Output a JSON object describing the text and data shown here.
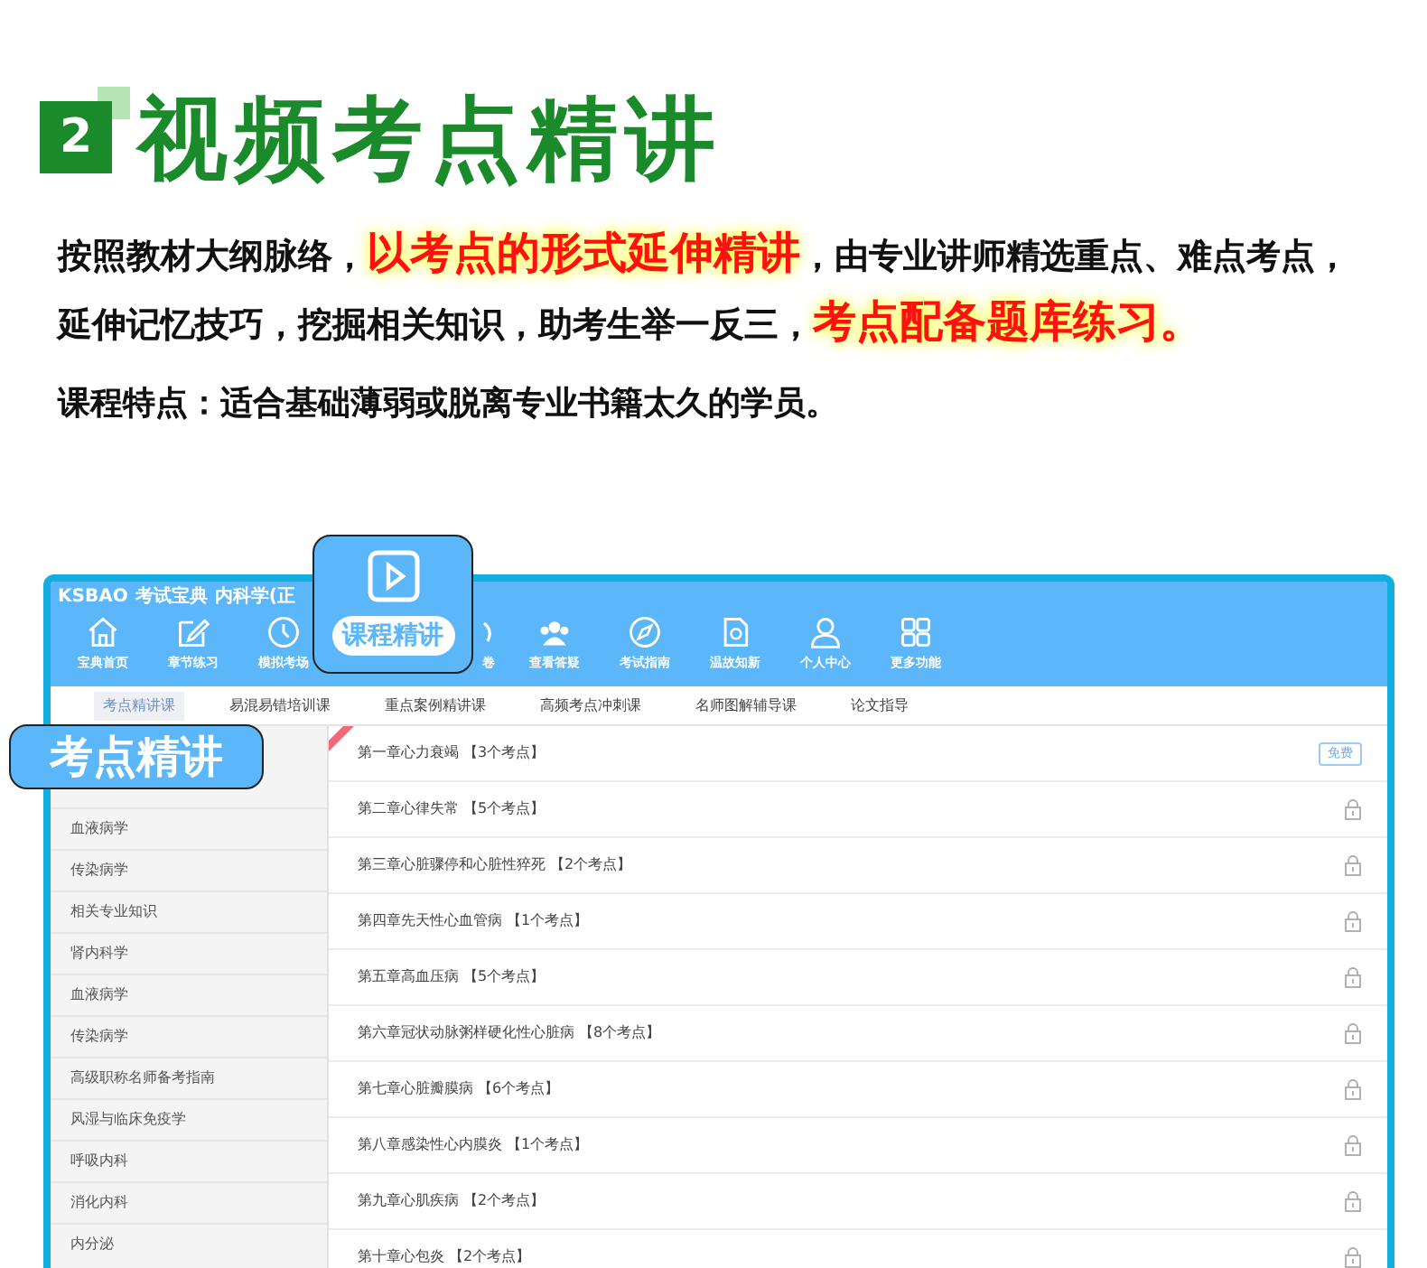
{
  "heading": {
    "badge": "2",
    "title": "视频考点精讲"
  },
  "intro": [
    {
      "text": "按照教材大纲脉络，",
      "highlight": false
    },
    {
      "text": "以考点的形式延伸精讲",
      "highlight": true
    },
    {
      "text": "，由专业讲师精选重点、难点考点，延伸记忆技巧，挖掘相关知识，助考生举一反三，",
      "highlight": false
    },
    {
      "text": "考点配备题库练习。",
      "highlight": true
    }
  ],
  "feature": "课程特点：适合基础薄弱或脱离专业书籍太久的学员。",
  "app": {
    "logo": "KSBAO",
    "brand": "考试宝典",
    "subject": "内科学(正",
    "nav": [
      {
        "label": "宝典首页",
        "kind": "home"
      },
      {
        "label": "章节练习",
        "kind": "edit"
      },
      {
        "label": "模拟考场",
        "kind": "clock"
      },
      {
        "kind": "none"
      },
      {
        "label": "卷",
        "kind": "partial"
      },
      {
        "label": "查看答疑",
        "kind": "people"
      },
      {
        "label": "考试指南",
        "kind": "compass"
      },
      {
        "label": "温故知新",
        "kind": "doc"
      },
      {
        "label": "个人中心",
        "kind": "user"
      },
      {
        "label": "更多功能",
        "kind": "grid"
      }
    ],
    "tabs": [
      {
        "label": "考点精讲课",
        "selected": true
      },
      {
        "label": "易混易错培训课",
        "selected": false
      },
      {
        "label": "重点案例精讲课",
        "selected": false
      },
      {
        "label": "高频考点冲刺课",
        "selected": false
      },
      {
        "label": "名师图解辅导课",
        "selected": false
      },
      {
        "label": "论文指导",
        "selected": false
      }
    ],
    "sidebar": [
      "血液病学",
      "传染病学",
      "相关专业知识",
      "肾内科学",
      "血液病学",
      "传染病学",
      "高级职称名师备考指南",
      "风湿与临床免疫学",
      "呼吸内科",
      "消化内科",
      "内分泌"
    ],
    "chapters": [
      {
        "title": "第一章心力衰竭 【3个考点】",
        "free": true,
        "badge": "免费",
        "new": true
      },
      {
        "title": "第二章心律失常 【5个考点】",
        "free": false,
        "new": false
      },
      {
        "title": "第三章心脏骤停和心脏性猝死 【2个考点】",
        "free": false,
        "new": false
      },
      {
        "title": "第四章先天性心血管病 【1个考点】",
        "free": false,
        "new": false
      },
      {
        "title": "第五章高血压病 【5个考点】",
        "free": false,
        "new": false
      },
      {
        "title": "第六章冠状动脉粥样硬化性心脏病 【8个考点】",
        "free": false,
        "new": false
      },
      {
        "title": "第七章心脏瓣膜病 【6个考点】",
        "free": false,
        "new": false
      },
      {
        "title": "第八章感染性心内膜炎 【1个考点】",
        "free": false,
        "new": false
      },
      {
        "title": "第九章心肌疾病 【2个考点】",
        "free": false,
        "new": false
      },
      {
        "title": "第十章心包炎 【2个考点】",
        "free": false,
        "new": false
      }
    ]
  },
  "callouts": {
    "course": "课程精讲",
    "section": "考点精讲"
  }
}
